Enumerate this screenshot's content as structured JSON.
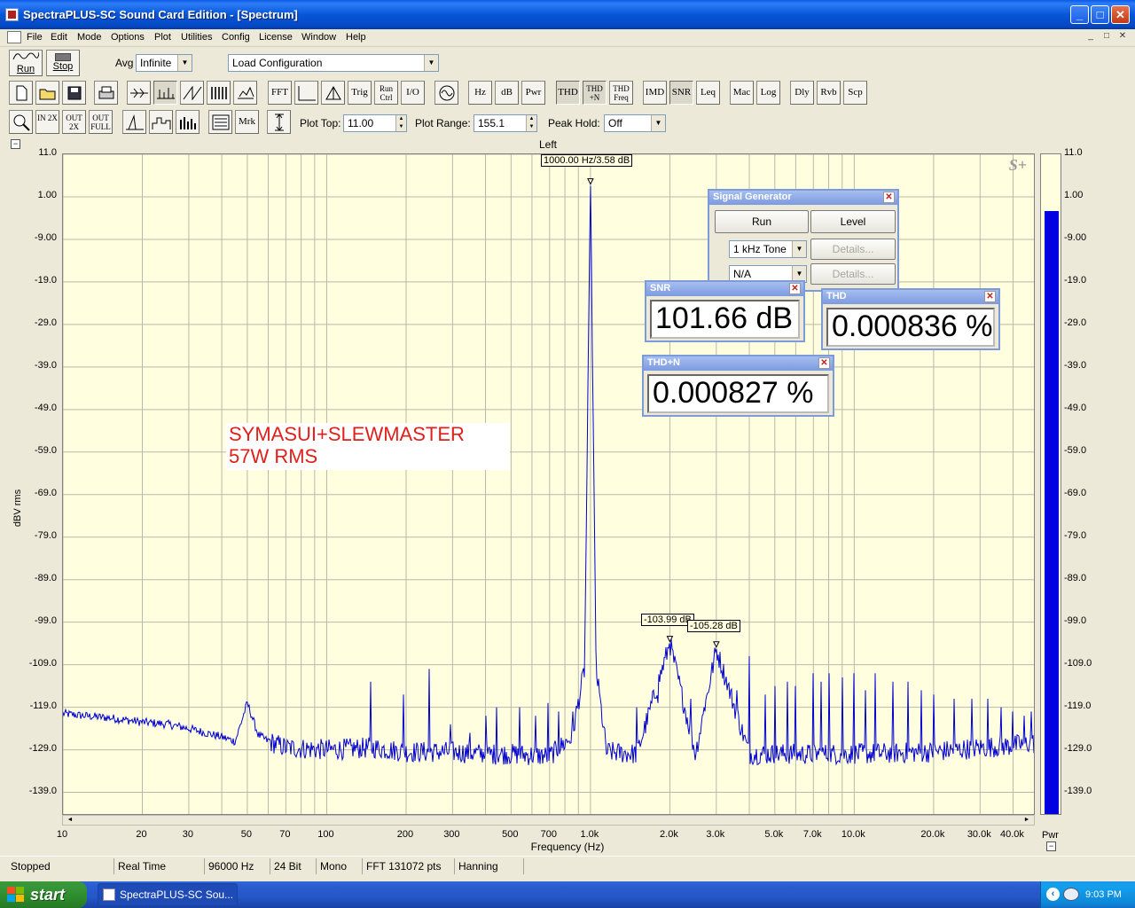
{
  "window": {
    "title": "SpectraPLUS-SC Sound Card Edition - [Spectrum]",
    "min_glyph": "_",
    "max_glyph": "□",
    "close_glyph": "✕"
  },
  "menu": [
    "File",
    "Edit",
    "Mode",
    "Options",
    "Plot",
    "Utilities",
    "Config",
    "License",
    "Window",
    "Help"
  ],
  "toolbar1": {
    "run_label": "Run",
    "stop_label": "Stop",
    "avg_label": "Avg",
    "avg_value": "Infinite",
    "config_value": "Load Configuration"
  },
  "toolbar2": [
    "FFT",
    "Trig",
    "Run Ctrl",
    "I/O",
    "Hz",
    "dB",
    "Pwr",
    "THD",
    "THD +N",
    "THD Freq",
    "IMD",
    "SNR",
    "Leq",
    "Mac",
    "Log",
    "Dly",
    "Rvb",
    "Scp"
  ],
  "toolbar3": {
    "zoom_in": "IN 2X",
    "zoom_out": "OUT 2X",
    "zoom_full": "OUT FULL",
    "mrk": "Mrk",
    "plot_top_label": "Plot Top:",
    "plot_top_value": "11.00",
    "plot_range_label": "Plot Range:",
    "plot_range_value": "155.1",
    "peak_hold_label": "Peak Hold:",
    "peak_hold_value": "Off"
  },
  "plot": {
    "channel": "Left",
    "y_axis_label": "dBV rms",
    "x_axis_label": "Frequency (Hz)",
    "y_ticks": [
      "11.0",
      "1.00",
      "-9.00",
      "-19.0",
      "-29.0",
      "-39.0",
      "-49.0",
      "-59.0",
      "-69.0",
      "-79.0",
      "-89.0",
      "-99.0",
      "-109.0",
      "-119.0",
      "-129.0",
      "-139.0"
    ],
    "x_ticks": [
      "10",
      "20",
      "30",
      "50",
      "70",
      "100",
      "200",
      "300",
      "500",
      "700",
      "1.0k",
      "2.0k",
      "3.0k",
      "5.0k",
      "7.0k",
      "10.0k",
      "20.0k",
      "30.0k",
      "40.0k"
    ],
    "pwr_label": "Pwr",
    "logo": "S+",
    "annotation_line1": "SYMASUI+SLEWMASTER",
    "annotation_line2": "57W RMS",
    "marker_fund": "1000.00 Hz/3.58 dB",
    "marker_h2": "-103.99 dB",
    "marker_h3": "-105.28 dB"
  },
  "chart_data": {
    "type": "line",
    "title": "",
    "xlabel": "Frequency (Hz)",
    "ylabel": "dBV rms",
    "x_scale": "log",
    "xlim": [
      10,
      48000
    ],
    "ylim": [
      -144.1,
      11
    ],
    "series": [
      {
        "x": [
          10,
          12,
          15,
          20,
          25,
          30,
          40,
          45,
          50,
          55,
          60,
          70,
          100,
          150,
          200,
          300,
          400,
          500,
          700,
          850,
          950,
          1000,
          1050,
          1150,
          1500,
          2000,
          2500,
          3000,
          4000,
          5000,
          7000,
          10000,
          20000,
          30000,
          40000,
          45000
        ],
        "y": [
          -120.5,
          -121,
          -121.5,
          -122.5,
          -123,
          -124,
          -126,
          -127,
          -118,
          -125.5,
          -127,
          -128.5,
          -129,
          -128.5,
          -129.5,
          -129.5,
          -130,
          -130,
          -130.5,
          -126,
          -110,
          3.58,
          -110,
          -129.5,
          -130,
          -103.99,
          -130,
          -105.28,
          -130,
          -130,
          -130,
          -130,
          -129.5,
          -128.5,
          -128,
          -127.5
        ]
      }
    ],
    "grid": true,
    "legend": "none",
    "markers": [
      "1000.00 Hz/3.58 dB",
      "-103.99 dB",
      "-105.28 dB"
    ],
    "pwr_level_dB": 3.58
  },
  "siggen": {
    "title": "Signal Generator",
    "run": "Run",
    "level": "Level",
    "waveform": "1 kHz Tone",
    "channel": "N/A",
    "details": "Details..."
  },
  "meters": {
    "snr_title": "SNR",
    "snr_value": "101.66 dB",
    "thd_title": "THD",
    "thd_value": "0.000836 %",
    "thdn_title": "THD+N",
    "thdn_value": "0.000827 %"
  },
  "status": [
    "Stopped",
    "Real Time",
    "96000 Hz",
    "24 Bit",
    "Mono",
    "FFT 131072 pts",
    "Hanning"
  ],
  "taskbar": {
    "start": "start",
    "item": "SpectraPLUS-SC Sou...",
    "clock": "9:03 PM"
  }
}
